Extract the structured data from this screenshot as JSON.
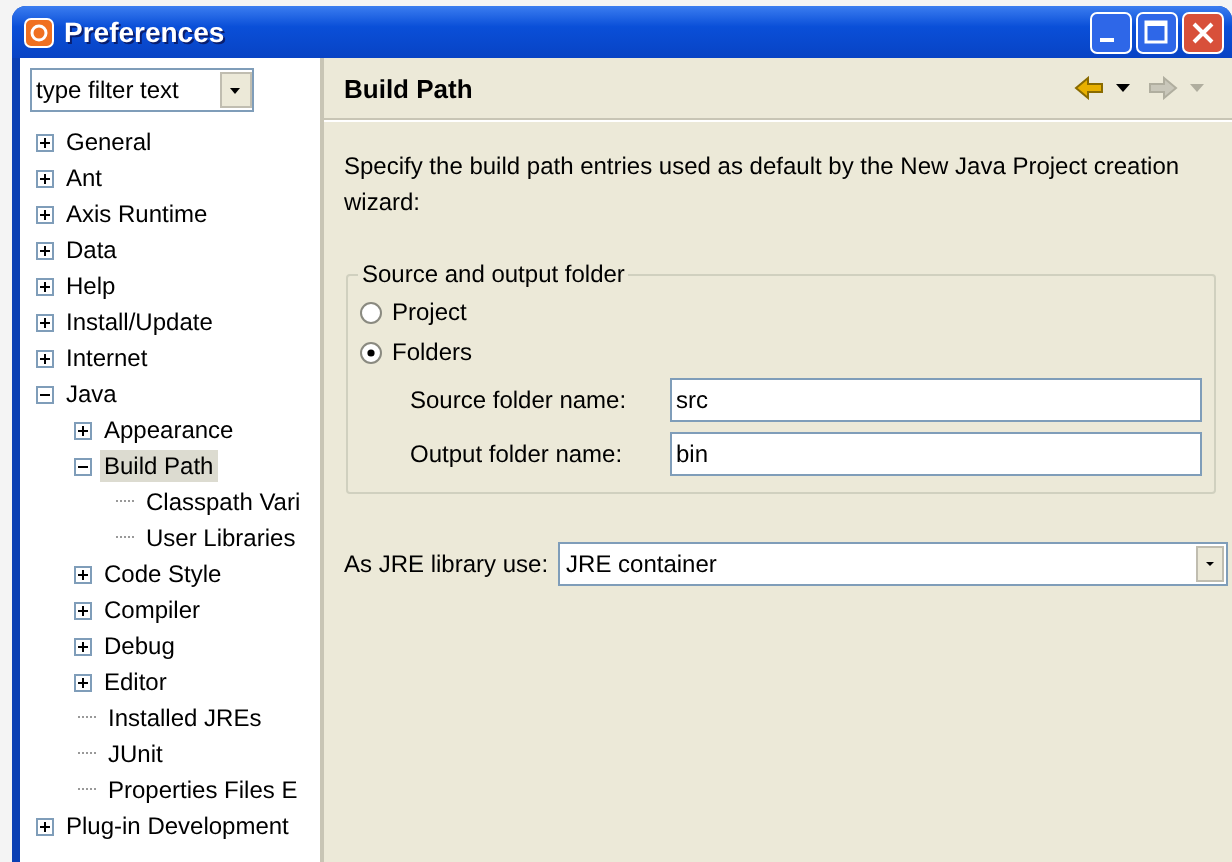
{
  "window": {
    "title": "Preferences"
  },
  "filter": {
    "placeholder": "type filter text"
  },
  "tree": [
    {
      "label": "General",
      "expanded": false,
      "selected": false
    },
    {
      "label": "Ant",
      "expanded": false,
      "selected": false
    },
    {
      "label": "Axis Runtime",
      "expanded": false,
      "selected": false
    },
    {
      "label": "Data",
      "expanded": false,
      "selected": false
    },
    {
      "label": "Help",
      "expanded": false,
      "selected": false
    },
    {
      "label": "Install/Update",
      "expanded": false,
      "selected": false
    },
    {
      "label": "Internet",
      "expanded": false,
      "selected": false
    },
    {
      "label": "Java",
      "expanded": true,
      "selected": false,
      "children": [
        {
          "label": "Appearance",
          "expanded": false,
          "selected": false
        },
        {
          "label": "Build Path",
          "expanded": true,
          "selected": true,
          "children": [
            {
              "label": "Classpath Vari",
              "selected": false
            },
            {
              "label": "User Libraries",
              "selected": false
            }
          ]
        },
        {
          "label": "Code Style",
          "expanded": false,
          "selected": false
        },
        {
          "label": "Compiler",
          "expanded": false,
          "selected": false
        },
        {
          "label": "Debug",
          "expanded": false,
          "selected": false
        },
        {
          "label": "Editor",
          "expanded": false,
          "selected": false
        },
        {
          "label": "Installed JREs",
          "selected": false
        },
        {
          "label": "JUnit",
          "selected": false
        },
        {
          "label": "Properties Files E",
          "selected": false
        }
      ]
    },
    {
      "label": "Plug-in Development",
      "expanded": false,
      "selected": false
    }
  ],
  "page": {
    "title": "Build Path",
    "back_disabled": false,
    "forward_disabled": true,
    "description": "Specify the build path entries used as default by the New Java Project creation wizard:",
    "group": {
      "title": "Source and output folder",
      "radios": [
        {
          "label": "Project",
          "selected": false
        },
        {
          "label": "Folders",
          "selected": true
        }
      ],
      "fields": [
        {
          "label": "Source folder name:",
          "value": "src"
        },
        {
          "label": "Output folder name:",
          "value": "bin"
        }
      ]
    },
    "jre": {
      "label": "As JRE library use:",
      "value": "JRE container"
    }
  }
}
